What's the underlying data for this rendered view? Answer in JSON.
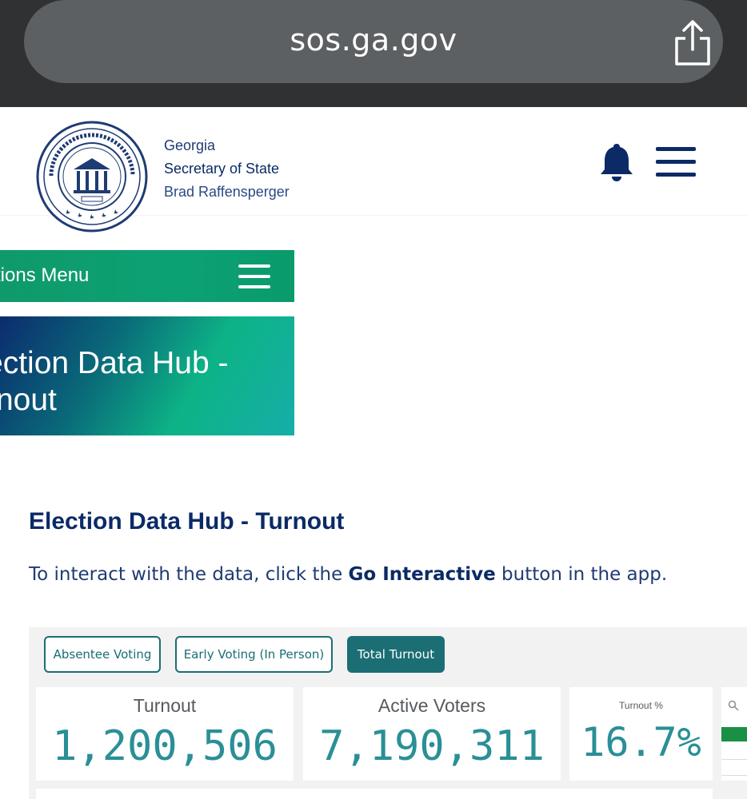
{
  "browser": {
    "url": "sos.ga.gov",
    "share_icon": "share-icon"
  },
  "header": {
    "seal_icon": "georgia-seal",
    "brand_line1": "Georgia",
    "brand_line2": "Secretary of State",
    "brand_line3": "Brad Raffensperger",
    "bell_icon": "bell-icon",
    "menu_icon": "hamburger-menu-icon"
  },
  "elections_menu": {
    "label": "tions Menu",
    "menu_icon": "hamburger-menu-icon"
  },
  "hero": {
    "line1": "ection Data Hub -",
    "line2": "rnout"
  },
  "main": {
    "heading": "Election Data Hub - Turnout",
    "intro_before": "To interact with the data, click the ",
    "intro_bold": "Go Interactive",
    "intro_after": " button in the app."
  },
  "app": {
    "tabs": [
      {
        "label": "Absentee Voting"
      },
      {
        "label": "Early Voting (In Person)"
      },
      {
        "label": "Total Turnout",
        "active": true
      }
    ],
    "stats": {
      "turnout_label": "Turnout",
      "turnout_value": "1,200,506",
      "active_label": "Active Voters",
      "active_value": "7,190,311",
      "pct_label": "Turnout %",
      "pct_value": "16.7%"
    }
  },
  "colors": {
    "header_navy": "#0b2a66",
    "green": "#0ca174",
    "teal": "#1b6e73",
    "stat_teal": "#2a8f96"
  }
}
